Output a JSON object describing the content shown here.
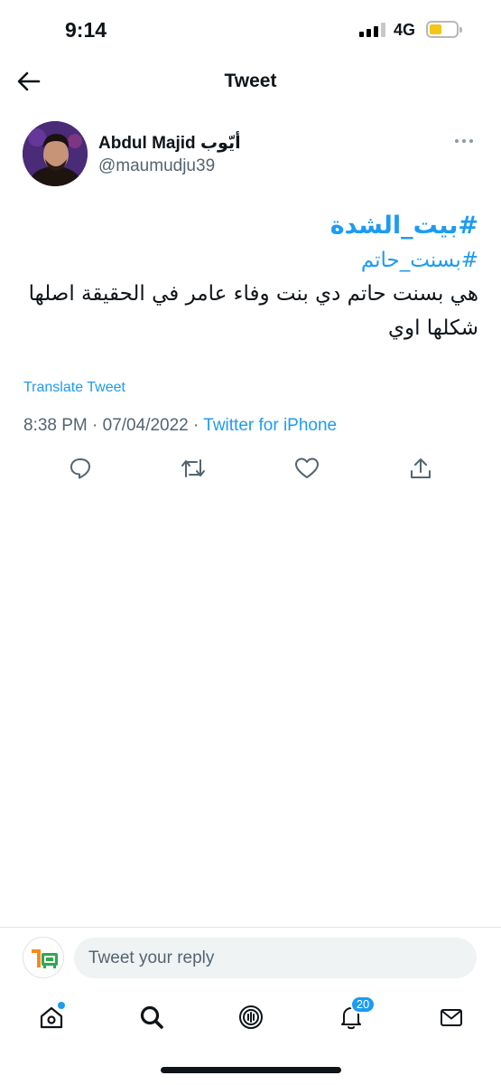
{
  "status_bar": {
    "time": "9:14",
    "network": "4G",
    "battery_color": "#f5c518"
  },
  "header": {
    "title": "Tweet",
    "back_icon": "arrow-left-icon"
  },
  "tweet": {
    "author": {
      "display_name": "Abdul Majid أيّوب",
      "handle": "@maumudju39"
    },
    "hashtags": [
      "#بيت_الشدة",
      "#بسنت_حاتم"
    ],
    "text": "هي بسنت حاتم دي بنت وفاء عامر في الحقيقة اصلها شكلها اوي",
    "translate_label": "Translate Tweet",
    "timestamp": "8:38 PM · 07/04/2022 · ",
    "source": "Twitter for iPhone"
  },
  "actions": [
    "reply-icon",
    "retweet-icon",
    "like-icon",
    "share-icon"
  ],
  "reply": {
    "placeholder": "Tweet your reply"
  },
  "tab_bar": {
    "items": [
      "home-icon",
      "search-icon",
      "spaces-icon",
      "notifications-icon",
      "messages-icon"
    ],
    "notification_count": "20"
  },
  "colors": {
    "accent": "#1d9bf0",
    "text": "#0f1419",
    "secondary": "#536471"
  }
}
